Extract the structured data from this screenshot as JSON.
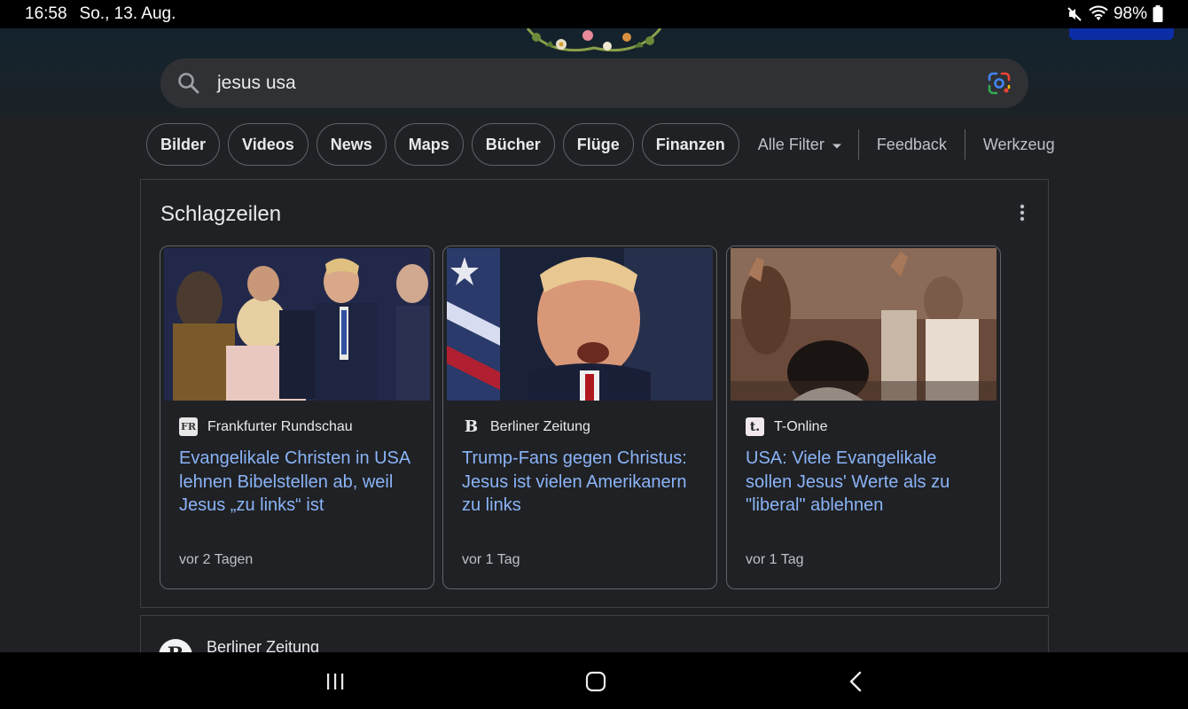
{
  "status_bar": {
    "time": "16:58",
    "date": "So., 13. Aug.",
    "battery": "98%"
  },
  "search": {
    "query": "jesus usa"
  },
  "chips": [
    "Bilder",
    "Videos",
    "News",
    "Maps",
    "Bücher",
    "Flüge",
    "Finanzen"
  ],
  "tools": {
    "all_filters": "Alle Filter",
    "feedback": "Feedback",
    "tools": "Werkzeug"
  },
  "headlines": {
    "title": "Schlagzeilen",
    "cards": [
      {
        "source": "Frankfurter Rundschau",
        "favicon_text": "FR",
        "title": "Evangelikale Christen in USA lehnen Bibelstellen ab, weil Jesus „zu links“ ist",
        "time": "vor 2 Tagen"
      },
      {
        "source": "Berliner Zeitung",
        "favicon_text": "B",
        "title": "Trump-Fans gegen Christus: Jesus ist vielen Amerikanern zu links",
        "time": "vor 1 Tag"
      },
      {
        "source": "T-Online",
        "favicon_text": "t.",
        "title": "USA: Viele Evangelikale sollen Jesus' Werte als zu \"liberal\" ablehnen",
        "time": "vor 1 Tag"
      }
    ]
  },
  "next_result": {
    "source": "Berliner Zeitung",
    "favicon_text": "B"
  },
  "colors": {
    "background": "#202124",
    "link": "#8ab4f8",
    "chip_border": "#5f6368"
  }
}
